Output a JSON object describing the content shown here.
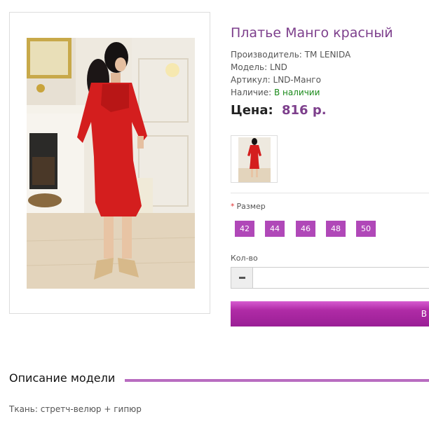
{
  "product": {
    "title": "Платье Манго красный",
    "manufacturer_label": "Производитель:",
    "manufacturer": "TM LENIDA",
    "model_label": "Модель:",
    "model": "LND",
    "sku_label": "Артикул:",
    "sku": "LND-Манго",
    "availability_label": "Наличие:",
    "availability": "В наличии",
    "price_label": "Цена:",
    "price": "816 р.",
    "availability_color": "#1a8a1a",
    "accent_color": "#7d3f8c"
  },
  "options": {
    "size_required_mark": "*",
    "size_label": "Размер",
    "sizes": [
      "42",
      "44",
      "46",
      "48",
      "50"
    ],
    "size_button_color": "#b048b8",
    "qty_label": "Кол-во",
    "qty_value": "",
    "minus_icon": "minus-icon"
  },
  "buy": {
    "label": "В",
    "color": "#b02ba6"
  },
  "description": {
    "heading": "Описание модели",
    "text": "Ткань: стретч-велюр + гипюр"
  }
}
